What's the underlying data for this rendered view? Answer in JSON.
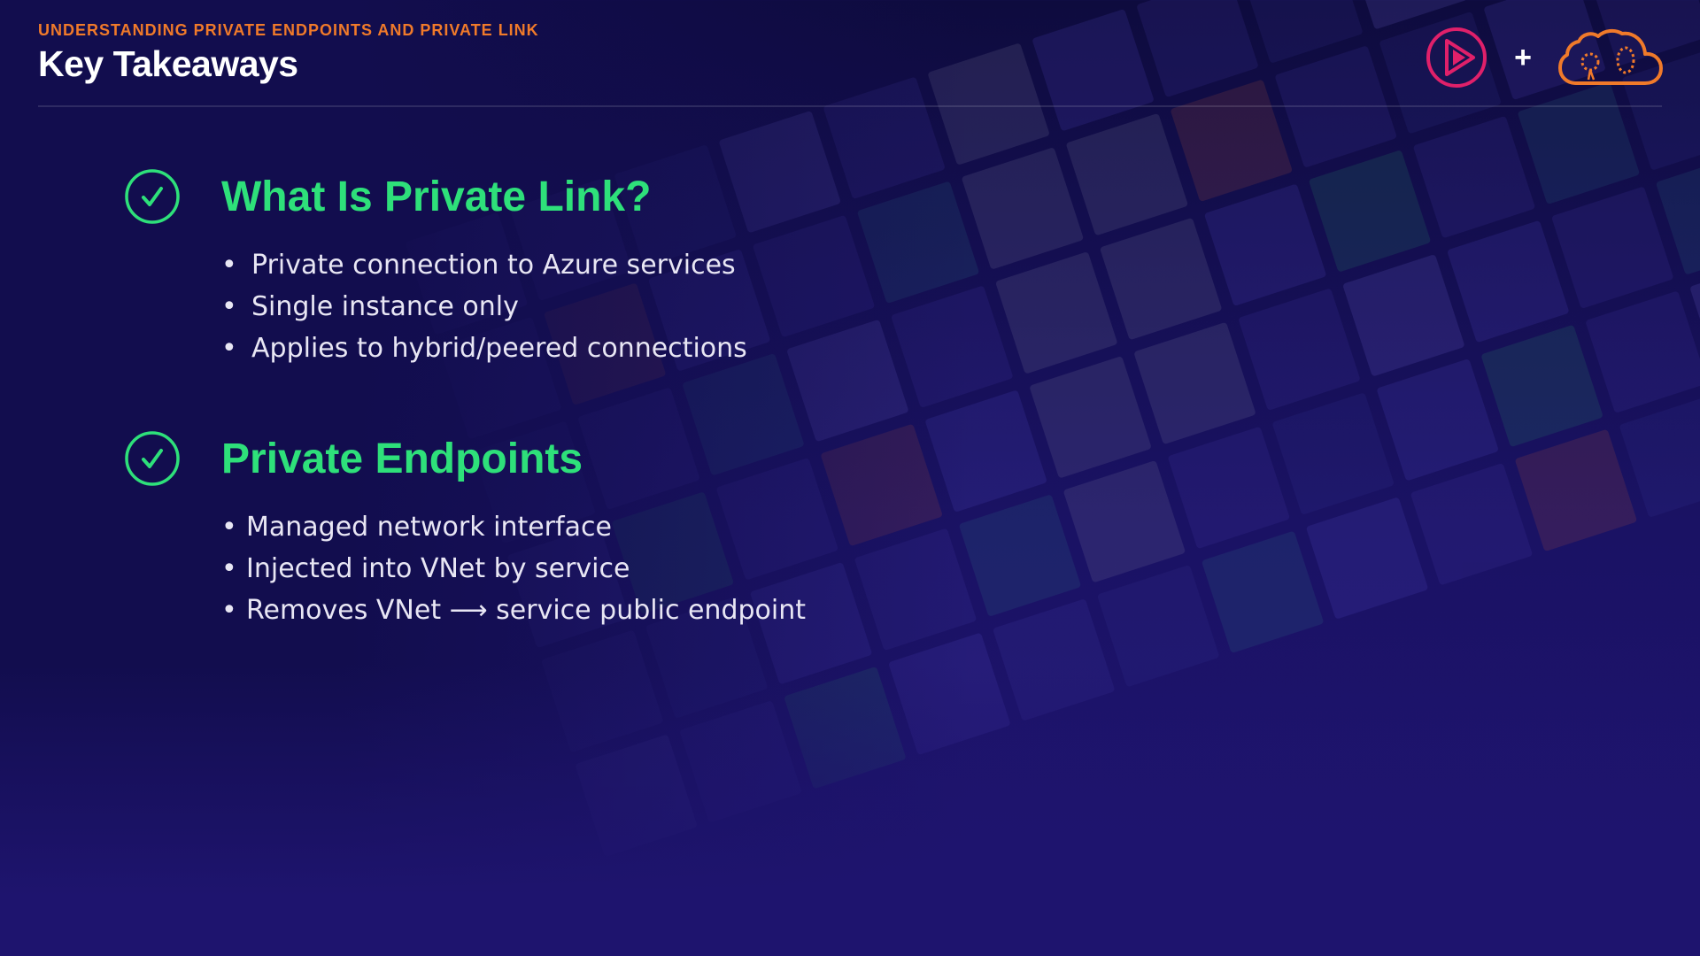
{
  "header": {
    "eyebrow": "UNDERSTANDING PRIVATE ENDPOINTS AND PRIVATE LINK",
    "title": "Key Takeaways"
  },
  "logos": {
    "left_logo_icon": "play-triangle-circle-icon",
    "plus": "+",
    "right_logo_icon": "cloud-guru-icon",
    "colors": {
      "play_logo": "#e0206a",
      "cloud_logo": "#f07a2a"
    }
  },
  "sections": [
    {
      "icon": "check-circle-icon",
      "title": "What Is Private Link?",
      "bullets": [
        "Private connection to Azure services",
        "Single instance only",
        "Applies to hybrid/peered connections"
      ]
    },
    {
      "icon": "check-circle-icon",
      "title": "Private Endpoints",
      "bullets": [
        "Managed network interface",
        "Injected into VNet by service",
        "Removes VNet ⟶ service public endpoint"
      ]
    }
  ],
  "colors": {
    "accent_green": "#2ee07a",
    "eyebrow_orange": "#f07a2a",
    "background": "#150f5a"
  }
}
